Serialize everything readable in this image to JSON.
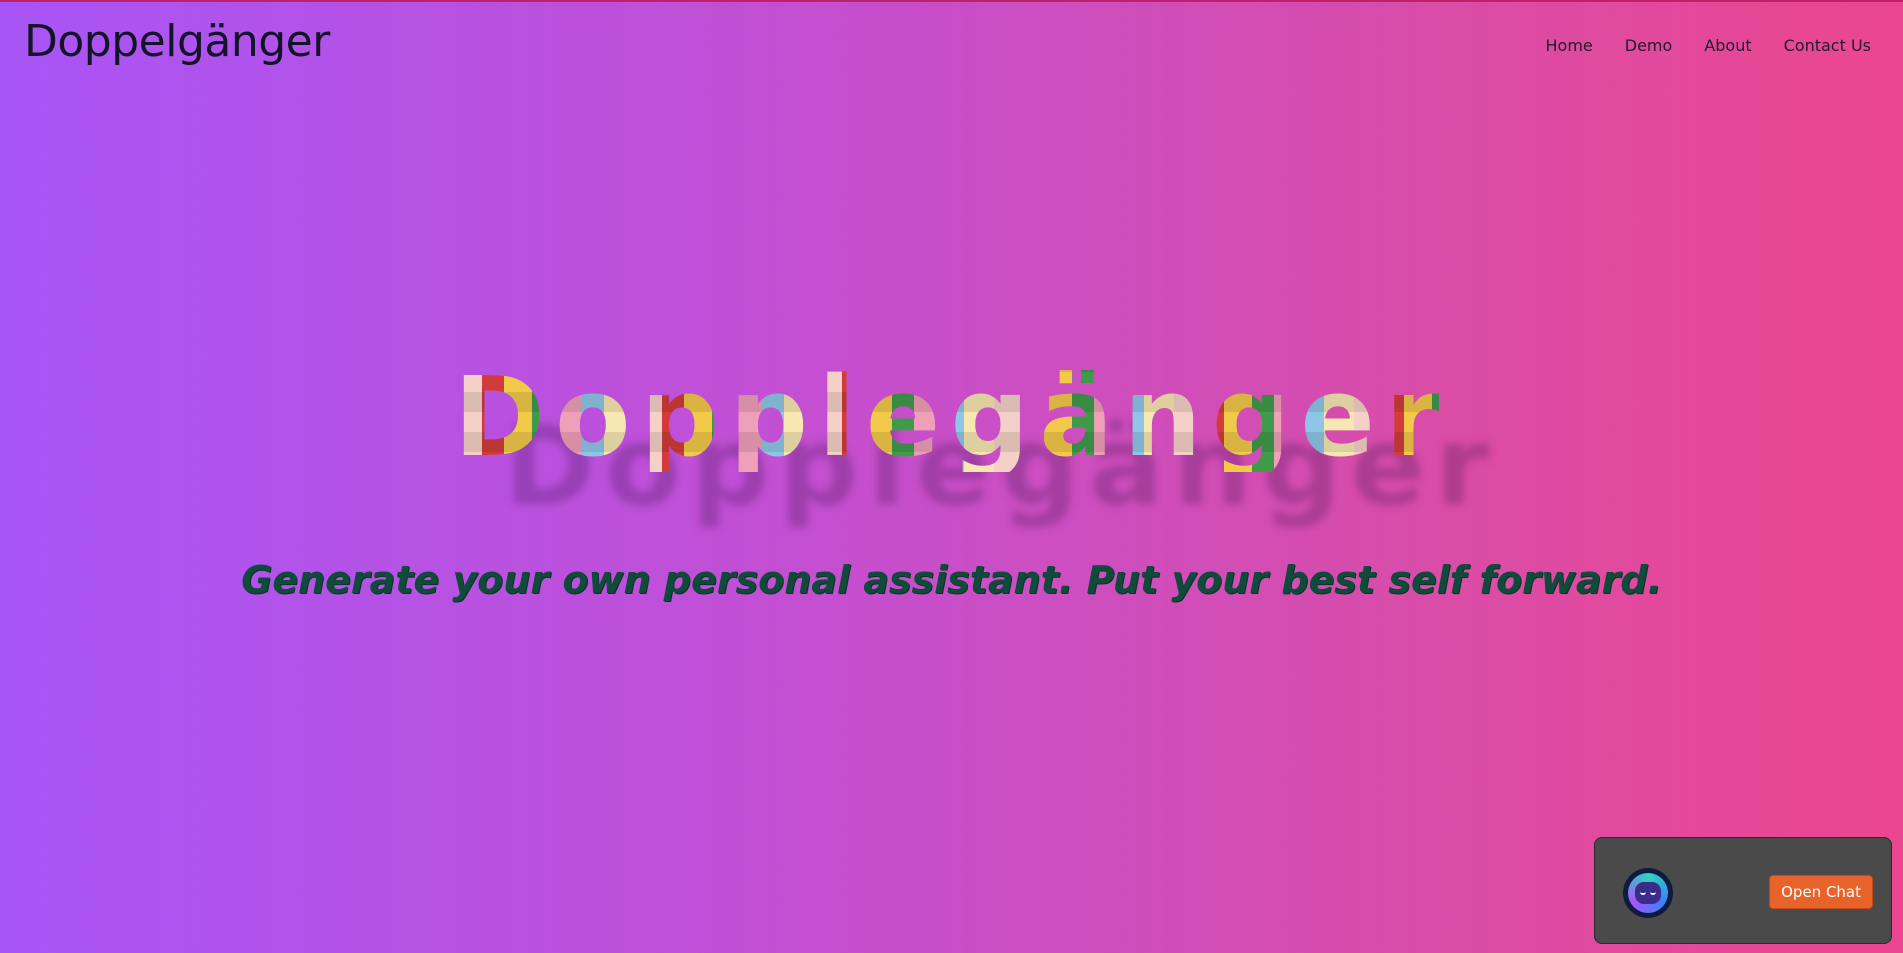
{
  "navbar": {
    "brand": "Doppelgänger",
    "links": [
      "Home",
      "Demo",
      "About",
      "Contact Us"
    ]
  },
  "hero": {
    "title": "Dopplegänger",
    "tagline": "Generate your own personal assistant. Put your best self forward."
  },
  "chat_widget": {
    "avatar_icon": "chatbot-face-icon",
    "button_label": "Open Chat"
  },
  "colors": {
    "gradient_start": "#a855f7",
    "gradient_end": "#ec4690",
    "tagline": "#0f4a3a",
    "chat_button": "#e8632a",
    "chat_panel": "#4a4a4a"
  }
}
